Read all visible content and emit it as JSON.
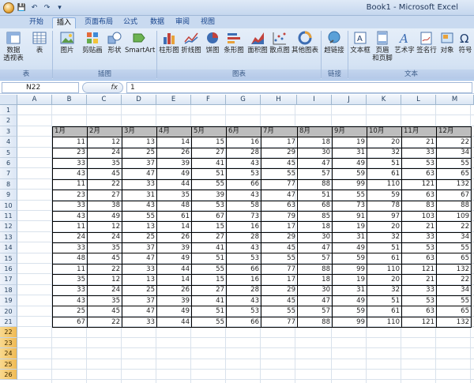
{
  "window": {
    "title": "Book1 - Microsoft Excel"
  },
  "tabs": [
    {
      "label": "开始"
    },
    {
      "label": "插入"
    },
    {
      "label": "页面布局"
    },
    {
      "label": "公式"
    },
    {
      "label": "数据"
    },
    {
      "label": "审阅"
    },
    {
      "label": "视图"
    }
  ],
  "active_tab": "插入",
  "ribbon": {
    "buttons": [
      {
        "label": "数据\n透视表",
        "icon": "pivottable-icon"
      },
      {
        "label": "表",
        "icon": "table-icon"
      },
      {
        "label": "图片",
        "icon": "picture-icon"
      },
      {
        "label": "剪贴画",
        "icon": "clipart-icon"
      },
      {
        "label": "形状",
        "icon": "shapes-icon"
      },
      {
        "label": "SmartArt",
        "icon": "smartart-icon"
      },
      {
        "label": "柱形图",
        "icon": "column-chart-icon"
      },
      {
        "label": "折线图",
        "icon": "line-chart-icon"
      },
      {
        "label": "饼图",
        "icon": "pie-chart-icon"
      },
      {
        "label": "条形图",
        "icon": "bar-chart-icon"
      },
      {
        "label": "面积图",
        "icon": "area-chart-icon"
      },
      {
        "label": "散点图",
        "icon": "scatter-chart-icon"
      },
      {
        "label": "其他图表",
        "icon": "other-charts-icon"
      },
      {
        "label": "超链接",
        "icon": "hyperlink-icon"
      },
      {
        "label": "文本框",
        "icon": "textbox-icon"
      },
      {
        "label": "页眉\n和页脚",
        "icon": "header-footer-icon"
      },
      {
        "label": "艺术字",
        "icon": "wordart-icon"
      },
      {
        "label": "签名行",
        "icon": "signature-icon"
      },
      {
        "label": "对象",
        "icon": "object-icon"
      },
      {
        "label": "符号",
        "icon": "symbol-icon"
      }
    ],
    "groups": [
      {
        "label": "表"
      },
      {
        "label": "插图"
      },
      {
        "label": "图表"
      },
      {
        "label": "链接"
      },
      {
        "label": "文本"
      }
    ]
  },
  "formula_bar": {
    "name_box": "N22",
    "fx": "fx",
    "value": "1"
  },
  "columns": [
    "A",
    "B",
    "C",
    "D",
    "E",
    "F",
    "G",
    "H",
    "I",
    "J",
    "K",
    "L",
    "M"
  ],
  "rows": [
    "1",
    "2",
    "3",
    "4",
    "5",
    "6",
    "7",
    "8",
    "9",
    "10",
    "11",
    "12",
    "13",
    "14",
    "15",
    "16",
    "17",
    "18",
    "19",
    "20",
    "21",
    "22",
    "23",
    "24",
    "25",
    "26"
  ],
  "table": {
    "headers": [
      "1月",
      "2月",
      "3月",
      "4月",
      "5月",
      "6月",
      "7月",
      "8月",
      "9月",
      "10月",
      "11月",
      "12月"
    ],
    "rows": [
      [
        "11",
        "12",
        "13",
        "14",
        "15",
        "16",
        "17",
        "18",
        "19",
        "20",
        "21",
        "22"
      ],
      [
        "23",
        "24",
        "25",
        "26",
        "27",
        "28",
        "29",
        "30",
        "31",
        "32",
        "33",
        "34"
      ],
      [
        "33",
        "35",
        "37",
        "39",
        "41",
        "43",
        "45",
        "47",
        "49",
        "51",
        "53",
        "55"
      ],
      [
        "43",
        "45",
        "47",
        "49",
        "51",
        "53",
        "55",
        "57",
        "59",
        "61",
        "63",
        "65"
      ],
      [
        "11",
        "22",
        "33",
        "44",
        "55",
        "66",
        "77",
        "88",
        "99",
        "110",
        "121",
        "132"
      ],
      [
        "23",
        "27",
        "31",
        "35",
        "39",
        "43",
        "47",
        "51",
        "55",
        "59",
        "63",
        "67"
      ],
      [
        "33",
        "38",
        "43",
        "48",
        "53",
        "58",
        "63",
        "68",
        "73",
        "78",
        "83",
        "88"
      ],
      [
        "43",
        "49",
        "55",
        "61",
        "67",
        "73",
        "79",
        "85",
        "91",
        "97",
        "103",
        "109"
      ],
      [
        "11",
        "12",
        "13",
        "14",
        "15",
        "16",
        "17",
        "18",
        "19",
        "20",
        "21",
        "22"
      ],
      [
        "24",
        "24",
        "25",
        "26",
        "27",
        "28",
        "29",
        "30",
        "31",
        "32",
        "33",
        "34"
      ],
      [
        "33",
        "35",
        "37",
        "39",
        "41",
        "43",
        "45",
        "47",
        "49",
        "51",
        "53",
        "55"
      ],
      [
        "48",
        "45",
        "47",
        "49",
        "51",
        "53",
        "55",
        "57",
        "59",
        "61",
        "63",
        "65"
      ],
      [
        "11",
        "22",
        "33",
        "44",
        "55",
        "66",
        "77",
        "88",
        "99",
        "110",
        "121",
        "132"
      ],
      [
        "35",
        "12",
        "13",
        "14",
        "15",
        "16",
        "17",
        "18",
        "19",
        "20",
        "21",
        "22"
      ],
      [
        "33",
        "24",
        "25",
        "26",
        "27",
        "28",
        "29",
        "30",
        "31",
        "32",
        "33",
        "34"
      ],
      [
        "43",
        "35",
        "37",
        "39",
        "41",
        "43",
        "45",
        "47",
        "49",
        "51",
        "53",
        "55"
      ],
      [
        "25",
        "45",
        "47",
        "49",
        "51",
        "53",
        "55",
        "57",
        "59",
        "61",
        "63",
        "65"
      ],
      [
        "67",
        "22",
        "33",
        "44",
        "55",
        "66",
        "77",
        "88",
        "99",
        "110",
        "121",
        "132"
      ]
    ]
  },
  "colors": {
    "header_fill": "#bdbdbd",
    "selected_row_header": "#f0bb55",
    "ribbon_bg": "#d5e3f4"
  }
}
